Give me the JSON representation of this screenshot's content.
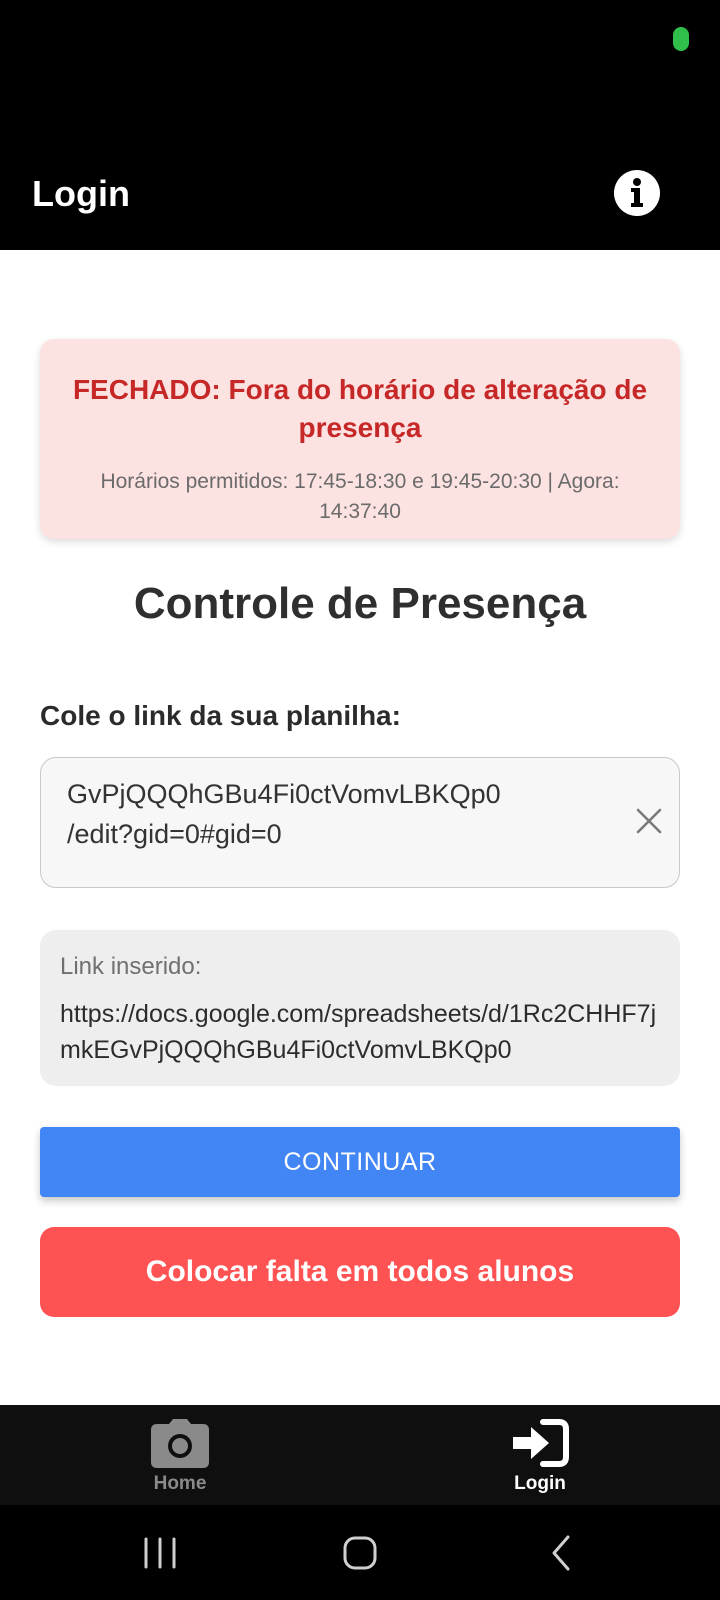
{
  "app": {
    "header_title": "Login"
  },
  "alert": {
    "title": "FECHADO: Fora do horário de alteração de presença",
    "subtitle": "Horários permitidos: 17:45-18:30 e 19:45-20:30 | Agora: 14:37:40"
  },
  "main": {
    "title": "Controle de Presença",
    "field_label": "Cole o link da sua planilha:",
    "input_visible_line_1": "GvPjQQQhGBu4Fi0ctVomvLBKQp0",
    "input_visible_line_2": "/edit?gid=0#gid=0",
    "inserted_label": "Link inserido:",
    "inserted_value": "https://docs.google.com/spreadsheets/d/1Rc2CHHF7jmkEGvPjQQQhGBu4Fi0ctVomvLBKQp0",
    "continue_label": "CONTINUAR",
    "falta_label": "Colocar falta em todos alunos"
  },
  "tabs": [
    {
      "label": "Home",
      "icon": "camera-icon",
      "active": false
    },
    {
      "label": "Login",
      "icon": "sign-in-icon",
      "active": true
    }
  ],
  "colors": {
    "alert_bg": "#fde2e2",
    "alert_text": "#c62828",
    "continue_button": "#4285f4",
    "falta_button": "#ff5252",
    "status_dot": "#2fbf4a"
  }
}
